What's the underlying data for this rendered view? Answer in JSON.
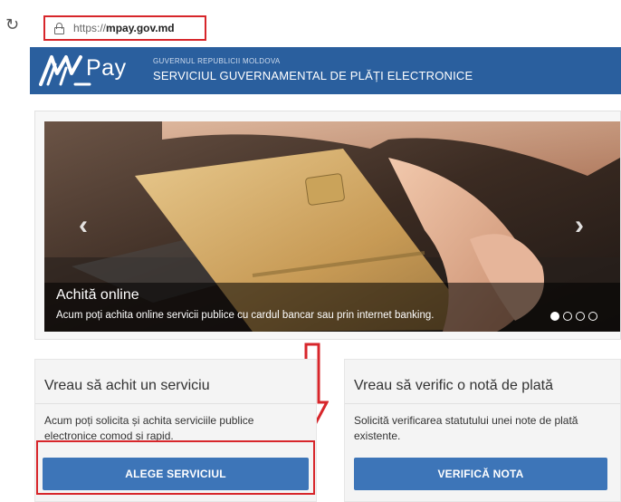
{
  "browser": {
    "reload_icon": "reload-icon",
    "url_prefix": "https://",
    "url_host": "mpay.gov.md",
    "highlight_color": "#d7262b"
  },
  "header": {
    "logo_text": "Pay",
    "org_name": "GUVERNUL REPUBLICII MOLDOVA",
    "service_name": "SERVICIUL GUVERNAMENTAL DE PLĂȚI ELECTRONICE",
    "background_color": "#2a5f9e"
  },
  "carousel": {
    "prev_icon": "‹",
    "next_icon": "›",
    "caption_title": "Achită online",
    "caption_text": "Acum poți achita online servicii publice cu cardul bancar sau prin internet banking.",
    "slide_count": 4,
    "active_slide": 1
  },
  "panels": {
    "pay": {
      "title": "Vreau să achit un serviciu",
      "description": "Acum poți solicita și achita serviciile publice electronice comod și rapid.",
      "button_label": "ALEGE SERVICIUL"
    },
    "verify": {
      "title": "Vreau să verific o notă de plată",
      "description": "Solicită verificarea statutului unei note de plată existente.",
      "button_label": "VERIFICĂ NOTA"
    }
  },
  "colors": {
    "button": "#3d75b8",
    "annotation_red": "#d7262b"
  }
}
